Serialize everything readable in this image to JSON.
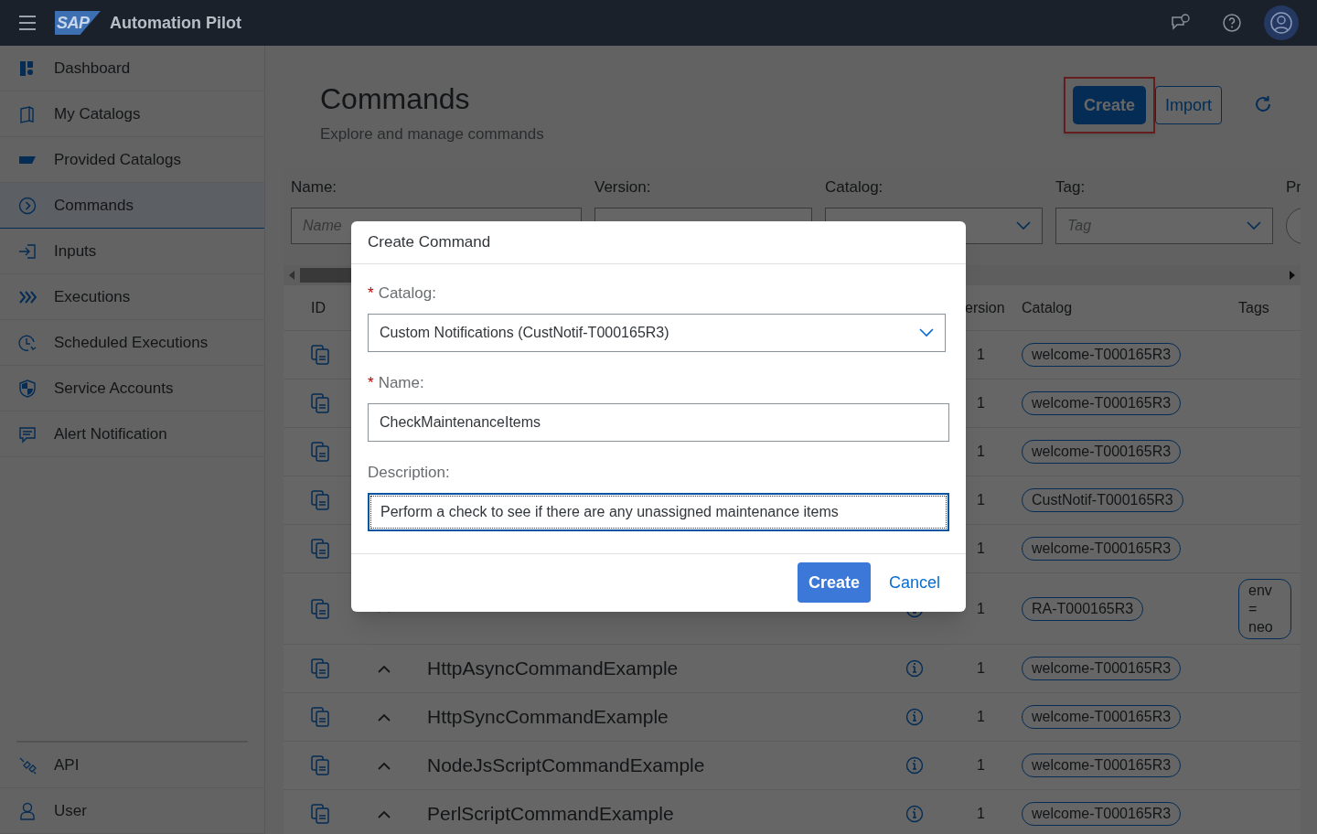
{
  "app": {
    "logo": "SAP",
    "title": "Automation Pilot"
  },
  "sidebar": {
    "items": [
      {
        "label": "Dashboard",
        "selected": false
      },
      {
        "label": "My Catalogs",
        "selected": false
      },
      {
        "label": "Provided Catalogs",
        "selected": false
      },
      {
        "label": "Commands",
        "selected": true
      },
      {
        "label": "Inputs",
        "selected": false
      },
      {
        "label": "Executions",
        "selected": false
      },
      {
        "label": "Scheduled Executions",
        "selected": false
      },
      {
        "label": "Service Accounts",
        "selected": false
      },
      {
        "label": "Alert Notification",
        "selected": false
      }
    ],
    "footer_items": [
      {
        "label": "API",
        "selected": false
      },
      {
        "label": "User",
        "selected": false
      }
    ]
  },
  "page": {
    "title": "Commands",
    "subtitle": "Explore and manage commands",
    "actions": [
      {
        "label": "Create",
        "kind": "primary",
        "highlighted": true
      },
      {
        "label": "Import",
        "kind": "secondary",
        "highlighted": false
      }
    ]
  },
  "filters": [
    {
      "label": "Name:",
      "kind": "input",
      "placeholder": "Name"
    },
    {
      "label": "Version:",
      "kind": "input"
    },
    {
      "label": "Catalog:",
      "kind": "select"
    },
    {
      "label": "Tag:",
      "kind": "select",
      "placeholder": "Tag"
    },
    {
      "label": "Pr",
      "kind": "toggle"
    }
  ],
  "table": {
    "columns": [
      "ID",
      "ersion",
      "Catalog",
      "Tags"
    ],
    "rows": [
      {
        "version": "1",
        "catalog": "welcome-T000165R3"
      },
      {
        "version": "1",
        "catalog": "welcome-T000165R3"
      },
      {
        "version": "1",
        "catalog": "welcome-T000165R3"
      },
      {
        "version": "1",
        "catalog": "CustNotif-T000165R3"
      },
      {
        "version": "1",
        "catalog": "welcome-T000165R3"
      },
      {
        "version": "1",
        "catalog": "RA-T000165R3",
        "tags": [
          "env = neo"
        ]
      },
      {
        "name": "HttpAsyncCommandExample",
        "version": "1",
        "catalog": "welcome-T000165R3"
      },
      {
        "name": "HttpSyncCommandExample",
        "version": "1",
        "catalog": "welcome-T000165R3"
      },
      {
        "name": "NodeJsScriptCommandExample",
        "version": "1",
        "catalog": "welcome-T000165R3"
      },
      {
        "name": "PerlScriptCommandExample",
        "version": "1",
        "catalog": "welcome-T000165R3"
      }
    ]
  },
  "dialog": {
    "title": "Create Command",
    "fields": [
      {
        "required_mark": "*",
        "label": "Catalog:",
        "kind": "select",
        "value": "Custom Notifications (CustNotif-T000165R3)",
        "focused": false
      },
      {
        "required_mark": "*",
        "label": "Name:",
        "kind": "input",
        "value": "CheckMaintenanceItems",
        "focused": false
      },
      {
        "label": "Description:",
        "kind": "input",
        "value": "Perform a check to see if there are any unassigned maintenance items",
        "focused": true
      }
    ],
    "buttons": [
      {
        "label": "Create",
        "kind": "primary"
      },
      {
        "label": "Cancel",
        "kind": "link"
      }
    ]
  }
}
